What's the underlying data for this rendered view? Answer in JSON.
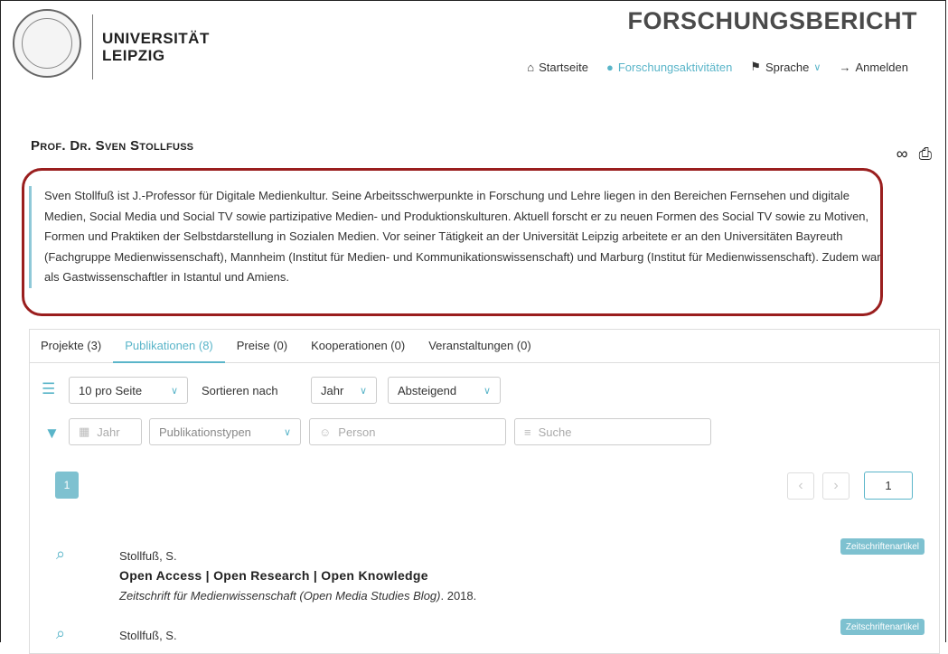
{
  "header": {
    "university_line1": "UNIVERSITÄT",
    "university_line2": "LEIPZIG",
    "site_title": "FORSCHUNGSBERICHT",
    "nav": [
      {
        "label": "Startseite",
        "icon": "home-icon"
      },
      {
        "label": "Forschungsaktivitäten",
        "icon": "globe-icon",
        "active": true
      },
      {
        "label": "Sprache",
        "icon": "flag-icon"
      },
      {
        "label": "Anmelden",
        "icon": "sign-in-icon"
      }
    ]
  },
  "person": {
    "title": "Prof. Dr. Sven Stollfuß",
    "bio": "Sven Stollfuß ist J.-Professor für Digitale Medienkultur. Seine Arbeitsschwerpunkte in Forschung und Lehre liegen in den Bereichen Fernsehen und digitale Medien, Social Media und Social TV sowie partizipative Medien- und Produktionskulturen. Aktuell forscht er zu neuen Formen des Social TV sowie zu Motiven, Formen und Praktiken der Selbstdarstellung in Sozialen Medien. Vor seiner Tätigkeit an der Universität Leipzig arbeitete er an den Universitäten Bayreuth (Fachgruppe Medienwissenschaft), Mannheim (Institut für Medien- und Kommunikationswissenschaft) und Marburg (Institut für Medienwissenschaft). Zudem war als Gastwissenschaftler in Istantul und Amiens."
  },
  "tabs": [
    {
      "label": "Projekte (3)"
    },
    {
      "label": "Publikationen (8)",
      "active": true
    },
    {
      "label": "Preise (0)"
    },
    {
      "label": "Kooperationen (0)"
    },
    {
      "label": "Veranstaltungen (0)"
    }
  ],
  "filters": {
    "per_page": "10 pro Seite",
    "sort_label": "Sortieren nach",
    "sort_field": "Jahr",
    "sort_order": "Absteigend",
    "year_placeholder": "Jahr",
    "pubtype_placeholder": "Publikationstypen",
    "person_placeholder": "Person",
    "search_placeholder": "Suche"
  },
  "pagination": {
    "current": "1",
    "page_input": "1"
  },
  "publications": [
    {
      "author": "Stollfuß, S.",
      "title": "Open Access | Open Research | Open Knowledge",
      "source": "Zeitschrift für Medienwissenschaft (Open Media Studies Blog)",
      "year": ". 2018.",
      "type": "Zeitschriftenartikel"
    },
    {
      "author": "Stollfuß, S.",
      "type": "Zeitschriftenartikel"
    }
  ],
  "colors": {
    "accent": "#5ab5c9",
    "highlight_border": "#9a1e1e"
  }
}
